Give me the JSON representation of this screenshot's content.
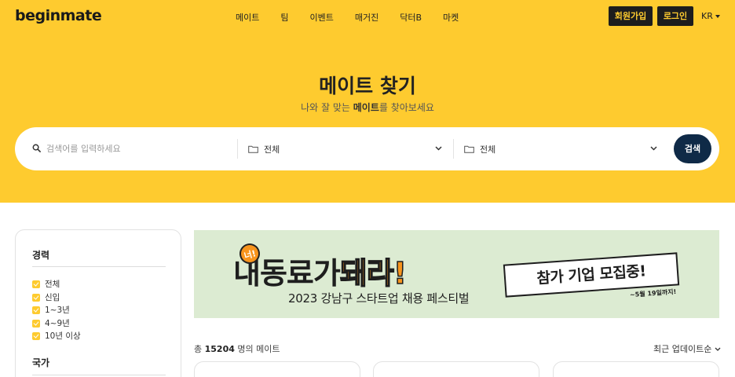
{
  "header": {
    "logo": "beginmate",
    "menu": [
      "메이트",
      "팀",
      "이벤트",
      "매거진",
      "닥터B",
      "마켓"
    ],
    "signup": "회원가입",
    "login": "로그인",
    "lang": "KR"
  },
  "hero": {
    "title": "메이트 찾기",
    "subtitle_pre": "나와 잘 맞는 ",
    "subtitle_bold": "메이트",
    "subtitle_post": "를 찾아보세요"
  },
  "search": {
    "placeholder": "검색어를 입력하세요",
    "select1": "전체",
    "select2": "전체",
    "button": "검색"
  },
  "sidebar": {
    "career_title": "경력",
    "career_options": [
      "전체",
      "신입",
      "1~3년",
      "4~9년",
      "10년 이상"
    ],
    "country_title": "국가"
  },
  "banner": {
    "tag": "너!",
    "headline_dark1": "내",
    "headline_dark2": "동료가",
    "headline_orange": "돼라!",
    "subline": "2023 강남구 스타트업 채용 페스티벌",
    "card": "참가 기업 모집중!",
    "date": "~5월 19일까지!"
  },
  "results": {
    "count_pre": "총 ",
    "count_num": "15204",
    "count_post": " 명의 메이트",
    "sort": "최근 업데이트순"
  },
  "colors": {
    "brand_yellow": "#FECB2F",
    "navy": "#0f2a47",
    "banner_bg": "#DCEBD2",
    "orange": "#F7941D"
  }
}
